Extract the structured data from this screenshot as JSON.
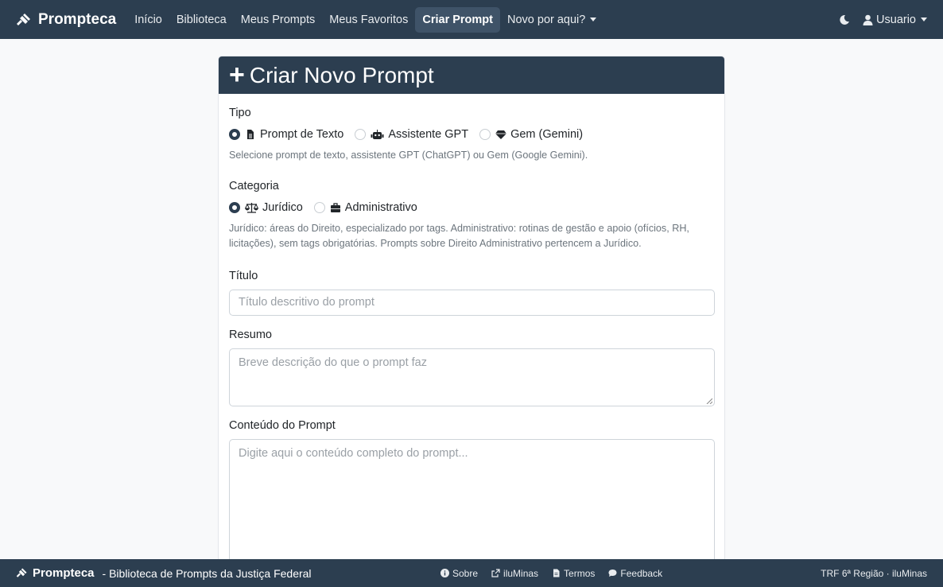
{
  "navbar": {
    "brand": "Prompteca",
    "links": [
      "Início",
      "Biblioteca",
      "Meus Prompts",
      "Meus Favoritos",
      "Criar Prompt",
      "Novo por aqui?"
    ],
    "user": "Usuario"
  },
  "card": {
    "title": "Criar Novo Prompt",
    "tipo": {
      "label": "Tipo",
      "options": [
        "Prompt de Texto",
        "Assistente GPT",
        "Gem (Gemini)"
      ],
      "help": "Selecione prompt de texto, assistente GPT (ChatGPT) ou Gem (Google Gemini)."
    },
    "categoria": {
      "label": "Categoria",
      "options": [
        "Jurídico",
        "Administrativo"
      ],
      "help": "Jurídico: áreas do Direito, especializado por tags. Administrativo: rotinas de gestão e apoio (ofícios, RH, licitações), sem tags obrigatórias. Prompts sobre Direito Administrativo pertencem a Jurídico."
    },
    "titulo": {
      "label": "Título",
      "placeholder": "Título descritivo do prompt"
    },
    "resumo": {
      "label": "Resumo",
      "placeholder": "Breve descrição do que o prompt faz"
    },
    "conteudo": {
      "label": "Conteúdo do Prompt",
      "placeholder": "Digite aqui o conteúdo completo do prompt..."
    }
  },
  "footer": {
    "brand": "Prompteca",
    "tagline": "- Biblioteca de Prompts da Justiça Federal",
    "links": [
      "Sobre",
      "iluMinas",
      "Termos",
      "Feedback"
    ],
    "right": "TRF 6ª Região · iluMinas"
  }
}
